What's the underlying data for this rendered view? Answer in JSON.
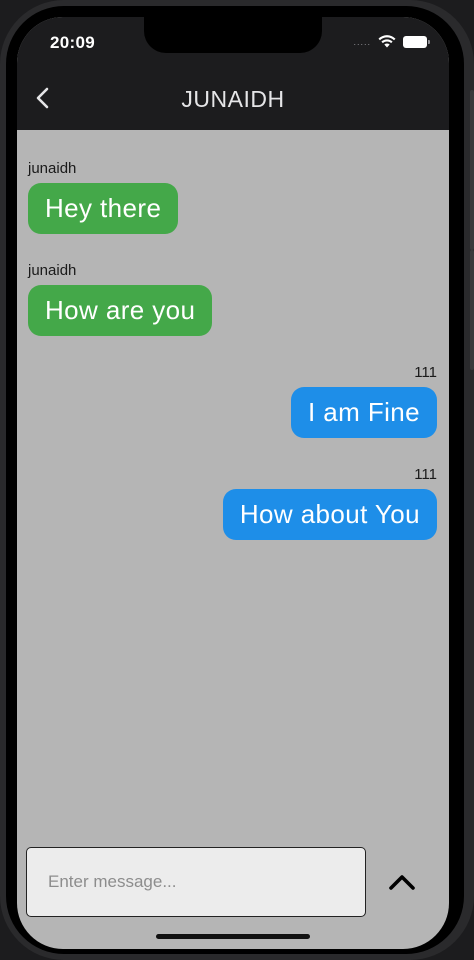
{
  "status_bar": {
    "time": "20:09",
    "signal": "....."
  },
  "header": {
    "title": "JUNAIDH"
  },
  "messages": [
    {
      "sender": "junaidh",
      "text": "Hey there",
      "direction": "incoming"
    },
    {
      "sender": "junaidh",
      "text": "How are you",
      "direction": "incoming"
    },
    {
      "sender": "111",
      "text": "I am Fine",
      "direction": "outgoing"
    },
    {
      "sender": "111",
      "text": "How about You",
      "direction": "outgoing"
    }
  ],
  "composer": {
    "placeholder": "Enter message...",
    "value": ""
  },
  "icons": {
    "back": "chevron-left-icon",
    "send": "chevron-up-icon",
    "wifi": "wifi-icon",
    "battery": "battery-icon"
  },
  "colors": {
    "incoming_bubble": "#44a849",
    "outgoing_bubble": "#1e8ee8",
    "chat_background": "#b5b5b5",
    "header_background": "#1c1c1e"
  }
}
